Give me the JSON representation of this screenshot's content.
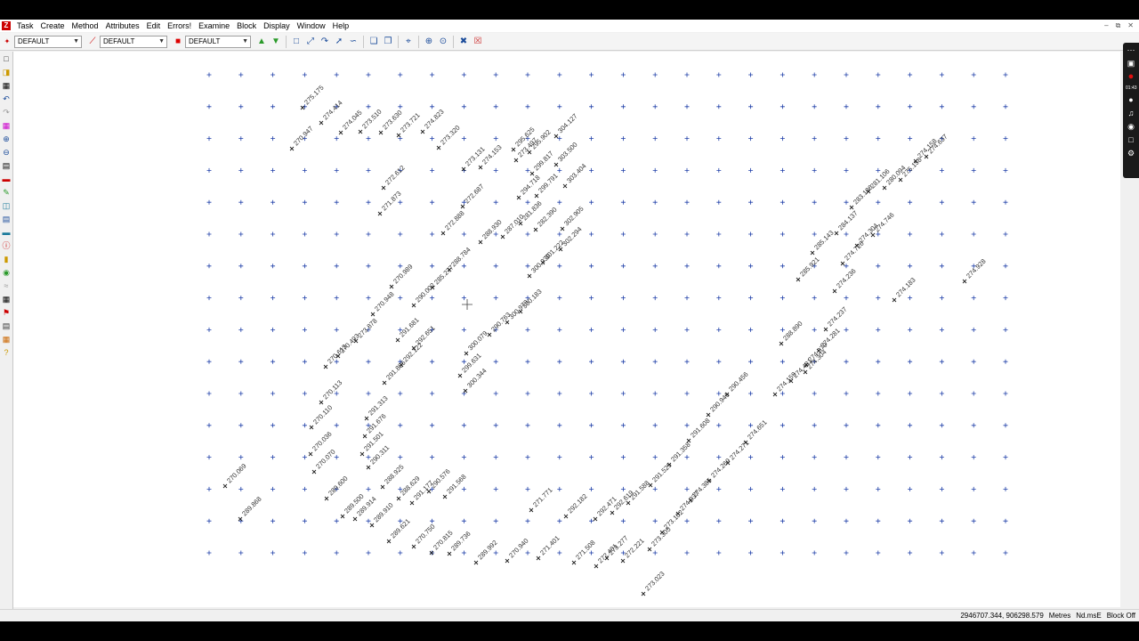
{
  "menu": {
    "items": [
      "Task",
      "Create",
      "Method",
      "Attributes",
      "Edit",
      "Errors!",
      "Examine",
      "Block",
      "Display",
      "Window",
      "Help"
    ]
  },
  "toolbar": {
    "combo1": "DEFAULT",
    "combo2": "DEFAULT",
    "combo3": "DEFAULT"
  },
  "status": {
    "coords": "2946707.344, 906298.579",
    "units": "Metres",
    "mode": "Nd.msE",
    "block": "Block Off"
  },
  "recorder": {
    "time": "01:43"
  },
  "colors": {
    "grid": "#1f3fa8",
    "points": "#222222",
    "labels": "#333333",
    "record": "#e01010"
  },
  "survey": {
    "grid": {
      "cols": 26,
      "rows": 16
    },
    "points": [
      [
        "275.175",
        340,
        121
      ],
      [
        "274.414",
        361,
        138
      ],
      [
        "270.947",
        328,
        167
      ],
      [
        "274.045",
        383,
        149
      ],
      [
        "273.510",
        405,
        148
      ],
      [
        "273.630",
        428,
        149
      ],
      [
        "273.721",
        448,
        152
      ],
      [
        "274.823",
        475,
        148
      ],
      [
        "273.320",
        493,
        166
      ],
      [
        "272.612",
        431,
        211
      ],
      [
        "271.873",
        427,
        240
      ],
      [
        "273.131",
        521,
        190
      ],
      [
        "272.687",
        520,
        232
      ],
      [
        "272.888",
        498,
        262
      ],
      [
        "274.153",
        540,
        188
      ],
      [
        "273.497",
        580,
        180
      ],
      [
        "295.625",
        577,
        168
      ],
      [
        "295.902",
        595,
        171
      ],
      [
        "304.127",
        625,
        153
      ],
      [
        "299.817",
        598,
        195
      ],
      [
        "303.500",
        625,
        185
      ],
      [
        "299.791",
        603,
        220
      ],
      [
        "303.404",
        635,
        209
      ],
      [
        "294.718",
        583,
        222
      ],
      [
        "281.836",
        585,
        251
      ],
      [
        "287.010",
        565,
        266
      ],
      [
        "282.390",
        602,
        258
      ],
      [
        "302.905",
        632,
        257
      ],
      [
        "288.930",
        540,
        272
      ],
      [
        "302.294",
        630,
        280
      ],
      [
        "301.222",
        610,
        295
      ],
      [
        "300.930",
        595,
        310
      ],
      [
        "270.989",
        440,
        322
      ],
      [
        "270.948",
        419,
        353
      ],
      [
        "290.002",
        465,
        343
      ],
      [
        "285.277",
        486,
        323
      ],
      [
        "288.784",
        505,
        303
      ],
      [
        "273.878",
        400,
        383
      ],
      [
        "291.681",
        447,
        382
      ],
      [
        "292.651",
        465,
        391
      ],
      [
        "290.763",
        550,
        376
      ],
      [
        "300.979",
        570,
        362
      ],
      [
        "300.183",
        585,
        350
      ],
      [
        "300.079",
        524,
        397
      ],
      [
        "299.631",
        517,
        422
      ],
      [
        "300.344",
        523,
        439
      ],
      [
        "270.613",
        366,
        412
      ],
      [
        "270.493",
        380,
        400
      ],
      [
        "270.113",
        361,
        452
      ],
      [
        "270.110",
        350,
        480
      ],
      [
        "270.036",
        349,
        510
      ],
      [
        "270.070",
        353,
        530
      ],
      [
        "291.313",
        412,
        470
      ],
      [
        "291.676",
        410,
        490
      ],
      [
        "291.885",
        432,
        430
      ],
      [
        "292.122",
        451,
        410
      ],
      [
        "291.501",
        407,
        510
      ],
      [
        "290.311",
        414,
        525
      ],
      [
        "288.925",
        430,
        547
      ],
      [
        "288.629",
        448,
        560
      ],
      [
        "291.177",
        463,
        565
      ],
      [
        "290.576",
        482,
        552
      ],
      [
        "291.568",
        500,
        558
      ],
      [
        "289.600",
        367,
        560
      ],
      [
        "289.500",
        385,
        580
      ],
      [
        "289.914",
        399,
        583
      ],
      [
        "289.910",
        418,
        590
      ],
      [
        "289.621",
        437,
        608
      ],
      [
        "270.750",
        465,
        614
      ],
      [
        "270.815",
        485,
        621
      ],
      [
        "289.736",
        505,
        622
      ],
      [
        "270.069",
        253,
        546
      ],
      [
        "289.868",
        270,
        583
      ],
      [
        "289.992",
        535,
        632
      ],
      [
        "270.940",
        570,
        630
      ],
      [
        "271.401",
        605,
        627
      ],
      [
        "271.508",
        645,
        632
      ],
      [
        "272.401",
        670,
        636
      ],
      [
        "273.023",
        723,
        667
      ],
      [
        "273.277",
        682,
        627
      ],
      [
        "271.771",
        597,
        573
      ],
      [
        "292.182",
        636,
        580
      ],
      [
        "292.471",
        669,
        583
      ],
      [
        "292.619",
        688,
        576
      ],
      [
        "291.588",
        706,
        565
      ],
      [
        "291.525",
        731,
        545
      ],
      [
        "291.358",
        752,
        522
      ],
      [
        "291.608",
        774,
        495
      ],
      [
        "290.946",
        796,
        466
      ],
      [
        "290.456",
        817,
        443
      ],
      [
        "272.221",
        700,
        630
      ],
      [
        "273.305",
        730,
        617
      ],
      [
        "273.102",
        744,
        598
      ],
      [
        "274.037",
        762,
        577
      ],
      [
        "274.385",
        776,
        562
      ],
      [
        "274.269",
        797,
        540
      ],
      [
        "274.271",
        818,
        520
      ],
      [
        "274.651",
        838,
        497
      ],
      [
        "274.159",
        871,
        443
      ],
      [
        "274.481",
        889,
        428
      ],
      [
        "274.304",
        905,
        418
      ],
      [
        "274.379",
        906,
        410
      ],
      [
        "274.281",
        920,
        394
      ],
      [
        "274.237",
        928,
        370
      ],
      [
        "288.890",
        878,
        386
      ],
      [
        "285.921",
        897,
        314
      ],
      [
        "285.143",
        913,
        284
      ],
      [
        "284.137",
        940,
        262
      ],
      [
        "274.726",
        947,
        296
      ],
      [
        "274.304",
        963,
        276
      ],
      [
        "274.746",
        981,
        264
      ],
      [
        "274.236",
        938,
        327
      ],
      [
        "283.106",
        957,
        233
      ],
      [
        "281.106",
        976,
        215
      ],
      [
        "280.094",
        994,
        211
      ],
      [
        "275.158",
        1012,
        202
      ],
      [
        "274.158",
        1029,
        181
      ],
      [
        "274.637",
        1041,
        176
      ],
      [
        "274.183",
        1005,
        337
      ],
      [
        "274.928",
        1084,
        316
      ]
    ]
  }
}
